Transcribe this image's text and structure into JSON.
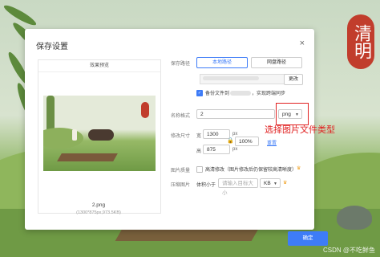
{
  "dialog": {
    "title": "保存设置",
    "close_glyph": "×"
  },
  "preview": {
    "header": "效果预览",
    "filename": "2.png",
    "meta": "(1300*875px,973.5KB)"
  },
  "form": {
    "save_path_label": "保存路径",
    "local_path_label": "本地路径",
    "cloud_path_label": "网盘路径",
    "change_label": "更改",
    "backup_label_pre": "备份文件到",
    "backup_label_post": "，实现跨端同步",
    "backup_checked": true,
    "name_format_label": "名称格式",
    "name_value": "2",
    "format_value": "png",
    "resize_label": "修改尺寸",
    "width_label": "宽",
    "height_label": "高",
    "width_value": "1300",
    "height_value": "875",
    "unit_px": "px",
    "scale_value": "100%",
    "reset_label": "重置",
    "quality_label": "图片质量",
    "quality_option": "高清修改（图片修改后仍保留较高清晰度）",
    "compress_label": "压缩图片",
    "compress_prefix": "体积小于",
    "compress_placeholder": "请输入目标大小",
    "compress_unit": "KB",
    "confirm_label": "确定"
  },
  "annotation": {
    "text": "选择图片文件类型"
  },
  "branding": {
    "seal_text": "清明",
    "watermark": "CSDN @不吃鲜鱼"
  },
  "colors": {
    "accent": "#3e7cf7",
    "annotation": "#e02020",
    "seal": "#c13d2c"
  }
}
